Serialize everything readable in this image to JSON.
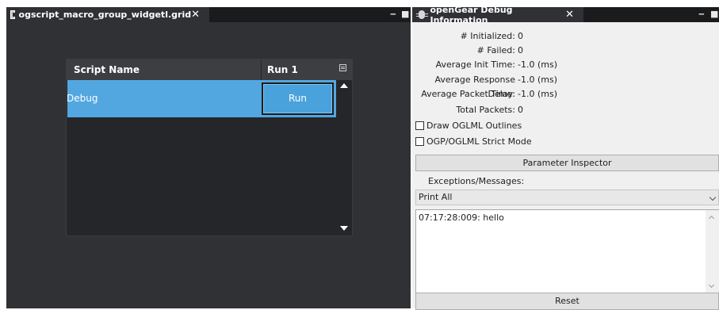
{
  "left_pane": {
    "tab_title": "ogscript_macro_group_widgetl.grid",
    "tab_close": "✕",
    "minimize": "‒",
    "maximize": "■",
    "grid": {
      "headers": [
        "Script Name",
        "Run 1"
      ],
      "rows": [
        {
          "name": "Debug",
          "run_label": "Run"
        }
      ]
    }
  },
  "right_pane": {
    "tab_title": "openGear Debug Information",
    "tab_close": "✕",
    "minimize": "‒",
    "maximize": "■",
    "stats": [
      {
        "label": "# Initialized:",
        "value": "0"
      },
      {
        "label": "# Failed:",
        "value": "0"
      },
      {
        "label": "Average Init Time:",
        "value": "-1.0 (ms)"
      },
      {
        "label": "Average Response Delay:",
        "value": "-1.0 (ms)"
      },
      {
        "label": "Average Packet Time:",
        "value": "-1.0 (ms)"
      },
      {
        "label": "Total Packets:",
        "value": "0"
      }
    ],
    "checkboxes": [
      {
        "label": "Draw OGLML Outlines",
        "checked": false
      },
      {
        "label": "OGP/OGLML Strict Mode",
        "checked": false
      }
    ],
    "parameter_inspector_label": "Parameter Inspector",
    "exceptions_label": "Exceptions/Messages:",
    "print_select_value": "Print All",
    "log_text": "07:17:28:009: hello",
    "reset_label": "Reset"
  }
}
